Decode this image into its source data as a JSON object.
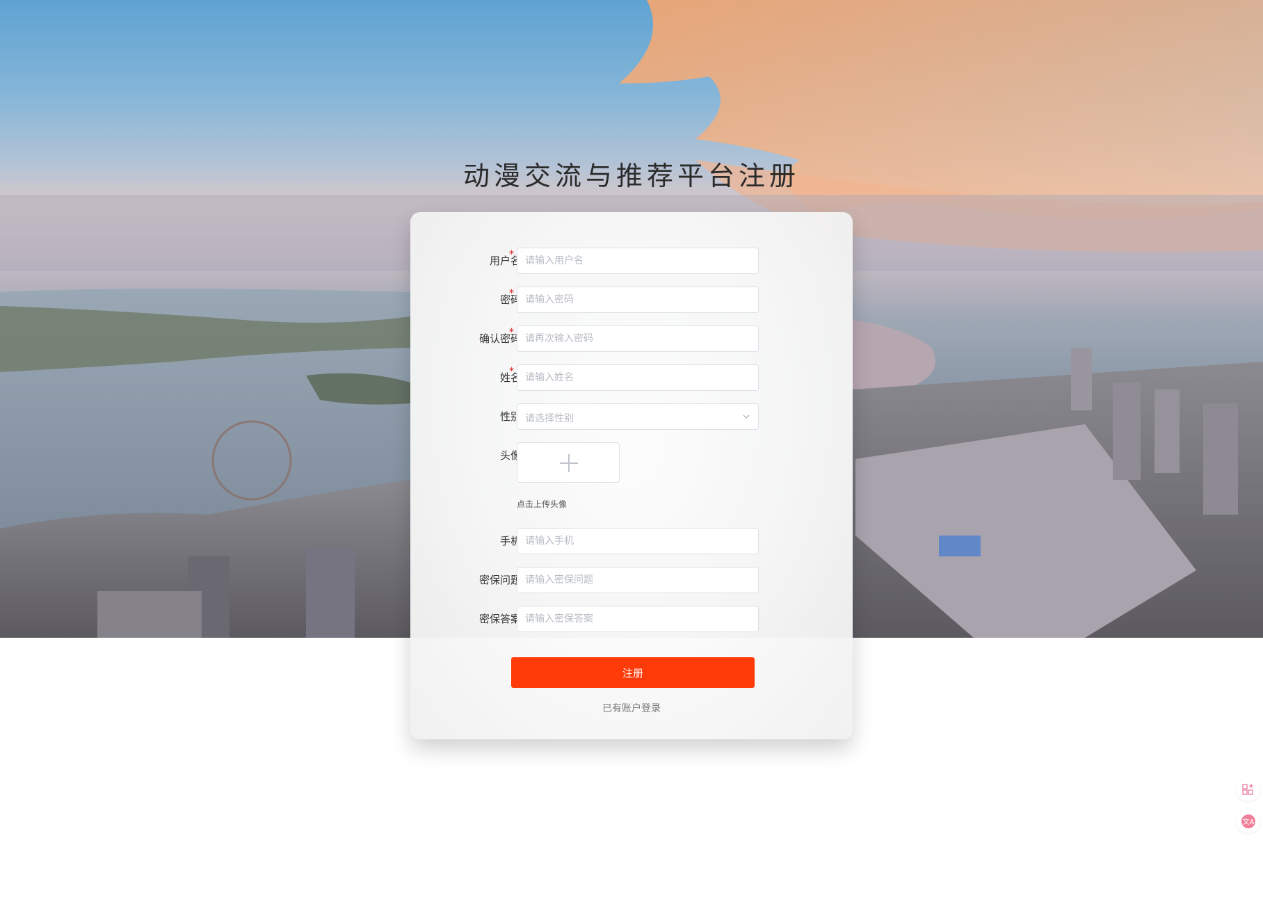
{
  "page_title": "动漫交流与推荐平台注册",
  "form": {
    "username": {
      "label": "用户名:",
      "placeholder": "请输入用户名",
      "required": true
    },
    "password": {
      "label": "密码:",
      "placeholder": "请输入密码",
      "required": true
    },
    "confirm_password": {
      "label": "确认密码:",
      "placeholder": "请再次输入密码",
      "required": true
    },
    "name": {
      "label": "姓名:",
      "placeholder": "请输入姓名",
      "required": true
    },
    "gender": {
      "label": "性别:",
      "placeholder": "请选择性别"
    },
    "avatar": {
      "label": "头像:",
      "hint": "点击上传头像"
    },
    "phone": {
      "label": "手机:",
      "placeholder": "请输入手机"
    },
    "security_question": {
      "label": "密保问题:",
      "placeholder": "请输入密保问题"
    },
    "security_answer": {
      "label": "密保答案:",
      "placeholder": "请输入密保答案"
    },
    "required_mark": "*"
  },
  "actions": {
    "register_label": "注册",
    "login_link": "已有账户登录"
  },
  "side_tools": {
    "apps_icon": "grid-sparkle-icon",
    "translate_icon": "translate-icon"
  },
  "colors": {
    "primary_button": "#ff3b0a",
    "required_star": "#e02020",
    "translate_badge": "#f0809a"
  }
}
